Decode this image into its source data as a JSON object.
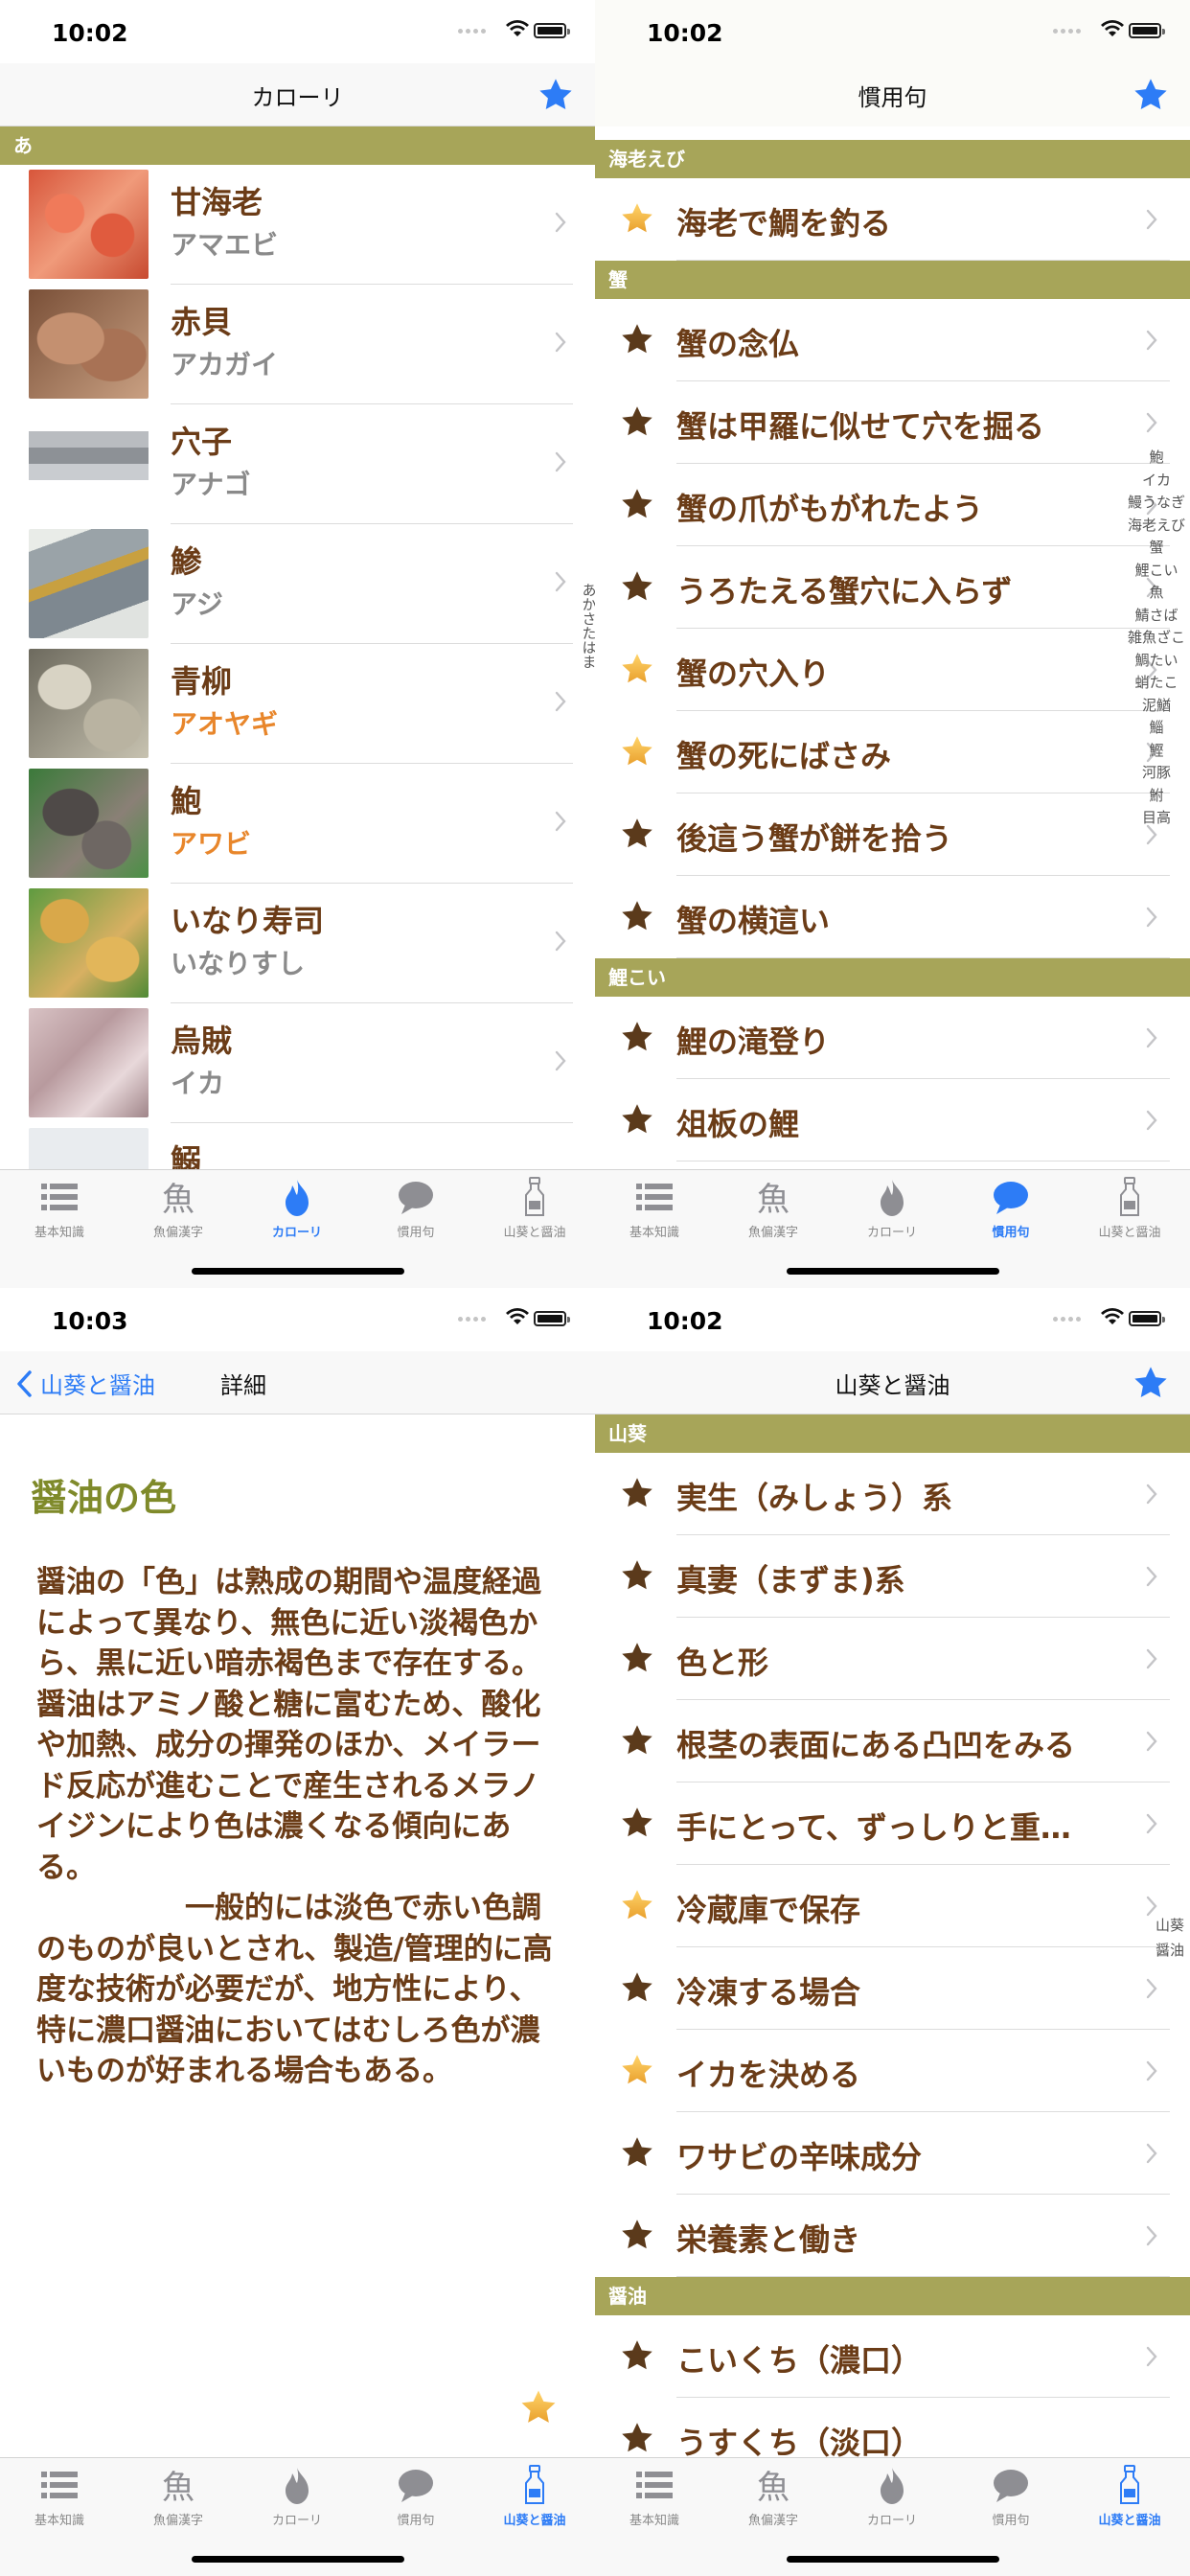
{
  "colors": {
    "accent": "#2d7cf6",
    "section_bg": "#a7a559",
    "item_text": "#6b3c17",
    "reading_gray": "#8a8a8a",
    "reading_orange": "#e8862b",
    "star_dark": "#5b3a1b",
    "star_gold": "#f2b33d",
    "detail_title": "#7f8a2a"
  },
  "tabs": [
    {
      "label": "基本知識",
      "icon": "list-icon"
    },
    {
      "label": "魚偏漢字",
      "icon": "fish-kanji-icon"
    },
    {
      "label": "カローリ",
      "icon": "flame-icon"
    },
    {
      "label": "慣用句",
      "icon": "speech-bubble-icon"
    },
    {
      "label": "山葵と醤油",
      "icon": "bottle-icon"
    }
  ],
  "panel1": {
    "time": "10:02",
    "title": "カローリ",
    "section": "あ",
    "items": [
      {
        "name": "甘海老",
        "reading": "アマエビ",
        "reading_color": "gray"
      },
      {
        "name": "赤貝",
        "reading": "アカガイ",
        "reading_color": "gray"
      },
      {
        "name": "穴子",
        "reading": "アナゴ",
        "reading_color": "gray"
      },
      {
        "name": "鯵",
        "reading": "アジ",
        "reading_color": "gray"
      },
      {
        "name": "青柳",
        "reading": "アオヤギ",
        "reading_color": "orange"
      },
      {
        "name": "鮑",
        "reading": "アワビ",
        "reading_color": "orange"
      },
      {
        "name": "いなり寿司",
        "reading": "いなりすし",
        "reading_color": "gray"
      },
      {
        "name": "烏賊",
        "reading": "イカ",
        "reading_color": "gray"
      },
      {
        "name": "鰯",
        "reading": "",
        "reading_color": "gray"
      }
    ],
    "index": [
      "あ",
      "か",
      "さ",
      "た",
      "は",
      "ま"
    ],
    "active_tab": 2
  },
  "panel2": {
    "time": "10:02",
    "title": "慣用句",
    "sections": [
      {
        "title": "海老えび",
        "items": [
          {
            "text": "海老で鯛を釣る",
            "star": "gold"
          }
        ]
      },
      {
        "title": "蟹",
        "items": [
          {
            "text": "蟹の念仏",
            "star": "dark"
          },
          {
            "text": "蟹は甲羅に似せて穴を掘る",
            "star": "dark"
          },
          {
            "text": "蟹の爪がもがれたよう",
            "star": "dark"
          },
          {
            "text": "うろたえる蟹穴に入らず",
            "star": "dark"
          },
          {
            "text": "蟹の穴入り",
            "star": "gold"
          },
          {
            "text": "蟹の死にばさみ",
            "star": "gold"
          },
          {
            "text": "後這う蟹が餅を拾う",
            "star": "dark"
          },
          {
            "text": "蟹の横這い",
            "star": "dark"
          }
        ]
      },
      {
        "title": "鯉こい",
        "items": [
          {
            "text": "鯉の滝登り",
            "star": "dark"
          },
          {
            "text": "俎板の鯉",
            "star": "dark"
          }
        ]
      }
    ],
    "index": [
      "鮑",
      "イカ",
      "鰻うなぎ",
      "海老えび",
      "蟹",
      "鯉こい",
      "魚",
      "鯖さば",
      "雑魚ざこ",
      "鯛たい",
      "蛸たこ",
      "泥鰌",
      "鯔",
      "鰹",
      "河豚",
      "鮒",
      "目高"
    ],
    "active_tab": 3
  },
  "panel3": {
    "time": "10:03",
    "back_label": "山葵と醤油",
    "title": "詳細",
    "detail_title": "醤油の色",
    "detail_body": "醤油の「色」は熟成の期間や温度経過によって異なり、無色に近い淡褐色から、黒に近い暗赤褐色まで存在する。醤油はアミノ酸と糖に富むため、酸化や加熱、成分の揮発のほか、メイラード反応が進むことで産生されるメラノイジンにより色は濃くなる傾向にある。\n　　　　　一般的には淡色で赤い色調のものが良いとされ、製造/管理的に高度な技術が必要だが、地方性により、特に濃口醤油においてはむしろ色が濃いものが好まれる場合もある。",
    "active_tab": 4
  },
  "panel4": {
    "time": "10:02",
    "title": "山葵と醤油",
    "sections": [
      {
        "title": "山葵",
        "items": [
          {
            "text": "実生（みしょう）系",
            "star": "dark"
          },
          {
            "text": "真妻（まずま)系",
            "star": "dark"
          },
          {
            "text": "色と形",
            "star": "dark"
          },
          {
            "text": "根茎の表面にある凸凹をみる",
            "star": "dark"
          },
          {
            "text": "手にとって、ずっしりと重…",
            "star": "dark"
          },
          {
            "text": "冷蔵庫で保存",
            "star": "gold"
          },
          {
            "text": "冷凍する場合",
            "star": "dark"
          },
          {
            "text": "イカを決める",
            "star": "gold"
          },
          {
            "text": "ワサビの辛味成分",
            "star": "dark"
          },
          {
            "text": "栄養素と働き",
            "star": "dark"
          }
        ]
      },
      {
        "title": "醤油",
        "items": [
          {
            "text": "こいくち（濃口）",
            "star": "dark"
          },
          {
            "text": "うすくち（淡口）",
            "star": "dark"
          }
        ]
      }
    ],
    "index": [
      "山葵",
      "醤油"
    ],
    "active_tab": 4
  }
}
